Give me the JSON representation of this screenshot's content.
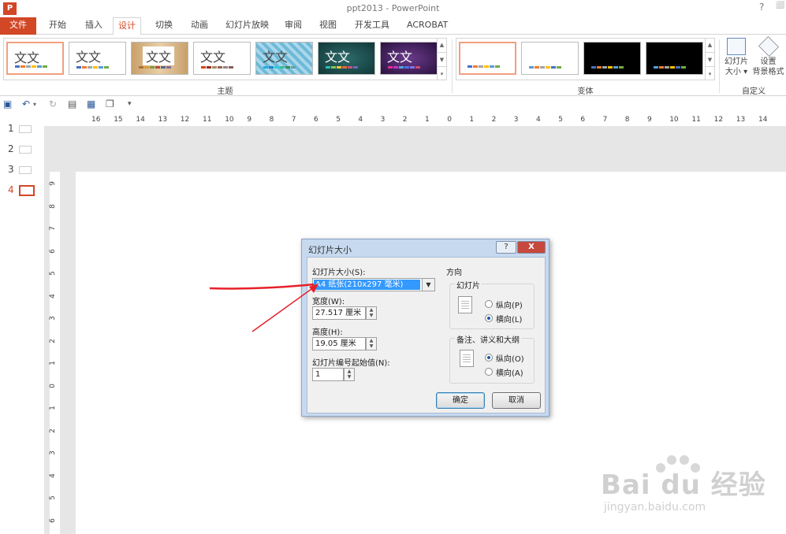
{
  "window": {
    "title": "ppt2013 - PowerPoint",
    "help": "?",
    "restore": "⬜"
  },
  "logo_text": "P",
  "tabs": [
    "文件",
    "开始",
    "插入",
    "设计",
    "切换",
    "动画",
    "幻灯片放映",
    "审阅",
    "视图",
    "开发工具",
    "ACROBAT"
  ],
  "active_tab": "设计",
  "themes": {
    "sample_text": "文文",
    "label": "主题"
  },
  "variants": {
    "label": "变体"
  },
  "customize": {
    "slide_size": "幻灯片\n大小 ▾",
    "slide_size_line1": "幻灯片",
    "slide_size_line2": "大小 ▾",
    "format_bg_line1": "设置",
    "format_bg_line2": "背景格式",
    "label": "自定义"
  },
  "ruler_h": [
    "16",
    "15",
    "14",
    "13",
    "12",
    "11",
    "10",
    "9",
    "8",
    "7",
    "6",
    "5",
    "4",
    "3",
    "2",
    "1",
    "0",
    "1",
    "2",
    "3",
    "4",
    "5",
    "6",
    "7",
    "8",
    "9",
    "10",
    "11",
    "12",
    "13",
    "14"
  ],
  "ruler_v": [
    "9",
    "8",
    "7",
    "6",
    "5",
    "4",
    "3",
    "2",
    "1",
    "0",
    "1",
    "2",
    "3",
    "4",
    "5",
    "6"
  ],
  "slides": [
    "1",
    "2",
    "3",
    "4"
  ],
  "dialog": {
    "title": "幻灯片大小",
    "help": "?",
    "close": "X",
    "size_label": "幻灯片大小(S):",
    "size_value": "A4 纸张(210x297 毫米)",
    "width_label": "宽度(W):",
    "width_value": "27.517 厘米",
    "height_label": "高度(H):",
    "height_value": "19.05 厘米",
    "start_label": "幻灯片编号起始值(N):",
    "start_value": "1",
    "orientation_label": "方向",
    "slides_group": "幻灯片",
    "portrait_p": "纵向(P)",
    "landscape_l": "横向(L)",
    "notes_group": "备注、讲义和大纲",
    "portrait_o": "纵向(O)",
    "landscape_a": "横向(A)",
    "ok": "确定",
    "cancel": "取消"
  },
  "watermark": {
    "logo": "Bai du 经验",
    "url": "jingyan.baidu.com"
  },
  "colors": {
    "accent": "#d24726",
    "arrow": "#e8202a"
  }
}
